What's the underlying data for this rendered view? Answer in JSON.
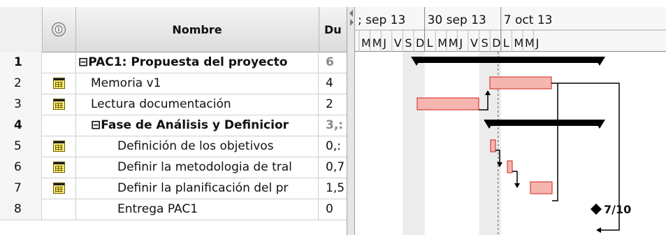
{
  "table": {
    "headers": {
      "info_icon": "ⓘ",
      "name": "Nombre",
      "duration": "Du"
    },
    "rows": [
      {
        "id": "1",
        "cal": false,
        "name": "⊟PAC1: Propuesta del proyecto",
        "dur": "6",
        "indent": 0,
        "bold": true,
        "dur_grey": true
      },
      {
        "id": "2",
        "cal": true,
        "name": "Memoria v1",
        "dur": "4",
        "indent": 1,
        "bold": false
      },
      {
        "id": "3",
        "cal": true,
        "name": "Lectura documentación",
        "dur": "2",
        "indent": 1,
        "bold": false
      },
      {
        "id": "4",
        "cal": false,
        "name": "⊟Fase de Análisis y Definicior",
        "dur": "3,:",
        "indent": 1,
        "bold": true,
        "dur_grey": true
      },
      {
        "id": "5",
        "cal": true,
        "name": "Definición de los objetivos",
        "dur": "0,:",
        "indent": 2,
        "bold": false
      },
      {
        "id": "6",
        "cal": true,
        "name": "Definir la metodologia de tral",
        "dur": "0,7",
        "indent": 2,
        "bold": false
      },
      {
        "id": "7",
        "cal": true,
        "name": "Definir la planificación del pr",
        "dur": "1,5",
        "indent": 2,
        "bold": false
      },
      {
        "id": "8",
        "cal": false,
        "name": "Entrega PAC1",
        "dur": "0",
        "indent": 2,
        "bold": false
      }
    ]
  },
  "gantt": {
    "weeks": [
      "; sep 13",
      "30 sep 13",
      "7 oct 13"
    ],
    "days": [
      "M",
      "M",
      "J",
      "V",
      "S",
      "D",
      "L",
      "M",
      "M",
      "J",
      "V",
      "S",
      "D",
      "L",
      "M",
      "M",
      "J"
    ],
    "milestone_label": "7/10"
  },
  "colors": {
    "task_fill": "#f6b6b0",
    "task_border": "#d0201a",
    "summary": "#000000"
  }
}
